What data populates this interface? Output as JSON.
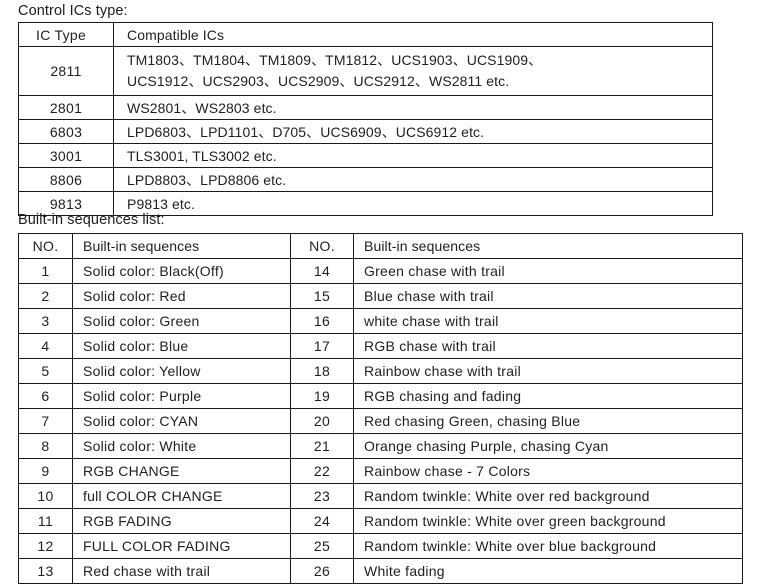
{
  "sections": {
    "ics_caption": "Control ICs type:",
    "sequences_caption": "Built-in sequences list:"
  },
  "ics_table": {
    "headers": {
      "type": "IC Type",
      "compatible": "Compatible ICs"
    },
    "rows": [
      {
        "type": "2811",
        "compatible_lines": [
          "TM1803、TM1804、TM1809、TM1812、UCS1903、UCS1909、",
          "UCS1912、UCS2903、UCS2909、UCS2912、WS2811 etc."
        ]
      },
      {
        "type": "2801",
        "compatible_lines": [
          "WS2801、WS2803 etc."
        ]
      },
      {
        "type": "6803",
        "compatible_lines": [
          "LPD6803、LPD1101、D705、UCS6909、UCS6912 etc."
        ]
      },
      {
        "type": "3001",
        "compatible_lines": [
          "TLS3001, TLS3002 etc."
        ]
      },
      {
        "type": "8806",
        "compatible_lines": [
          "LPD8803、LPD8806 etc."
        ]
      },
      {
        "type": "9813",
        "compatible_lines": [
          "P9813 etc."
        ]
      }
    ]
  },
  "sequences_table": {
    "headers": {
      "no_left": "NO.",
      "desc_left": "Built-in sequences",
      "no_right": "NO.",
      "desc_right": "Built-in sequences"
    },
    "rows": [
      {
        "no_left": "1",
        "desc_left": "Solid color: Black(Off)",
        "no_right": "14",
        "desc_right": "Green chase with trail"
      },
      {
        "no_left": "2",
        "desc_left": "Solid color: Red",
        "no_right": "15",
        "desc_right": "Blue chase with trail"
      },
      {
        "no_left": "3",
        "desc_left": "Solid color: Green",
        "no_right": "16",
        "desc_right": "white chase with trail"
      },
      {
        "no_left": "4",
        "desc_left": "Solid color: Blue",
        "no_right": "17",
        "desc_right": "RGB chase with trail"
      },
      {
        "no_left": "5",
        "desc_left": "Solid color: Yellow",
        "no_right": "18",
        "desc_right": "Rainbow chase with trail"
      },
      {
        "no_left": "6",
        "desc_left": "Solid color: Purple",
        "no_right": "19",
        "desc_right": "RGB chasing and fading"
      },
      {
        "no_left": "7",
        "desc_left": "Solid color: CYAN",
        "no_right": "20",
        "desc_right": "Red chasing Green, chasing Blue"
      },
      {
        "no_left": "8",
        "desc_left": "Solid color: White",
        "no_right": "21",
        "desc_right": "Orange chasing Purple, chasing Cyan"
      },
      {
        "no_left": "9",
        "desc_left": "RGB CHANGE",
        "no_right": "22",
        "desc_right": "Rainbow chase - 7 Colors"
      },
      {
        "no_left": "10",
        "desc_left": "full COLOR CHANGE",
        "no_right": "23",
        "desc_right": "Random twinkle: White over red background"
      },
      {
        "no_left": "11",
        "desc_left": "RGB FADING",
        "no_right": "24",
        "desc_right": "Random twinkle: White over green background"
      },
      {
        "no_left": "12",
        "desc_left": "FULL COLOR FADING",
        "no_right": "25",
        "desc_right": "Random twinkle: White over blue background"
      },
      {
        "no_left": "13",
        "desc_left": "Red chase with trail",
        "no_right": "26",
        "desc_right": "White fading"
      }
    ]
  }
}
